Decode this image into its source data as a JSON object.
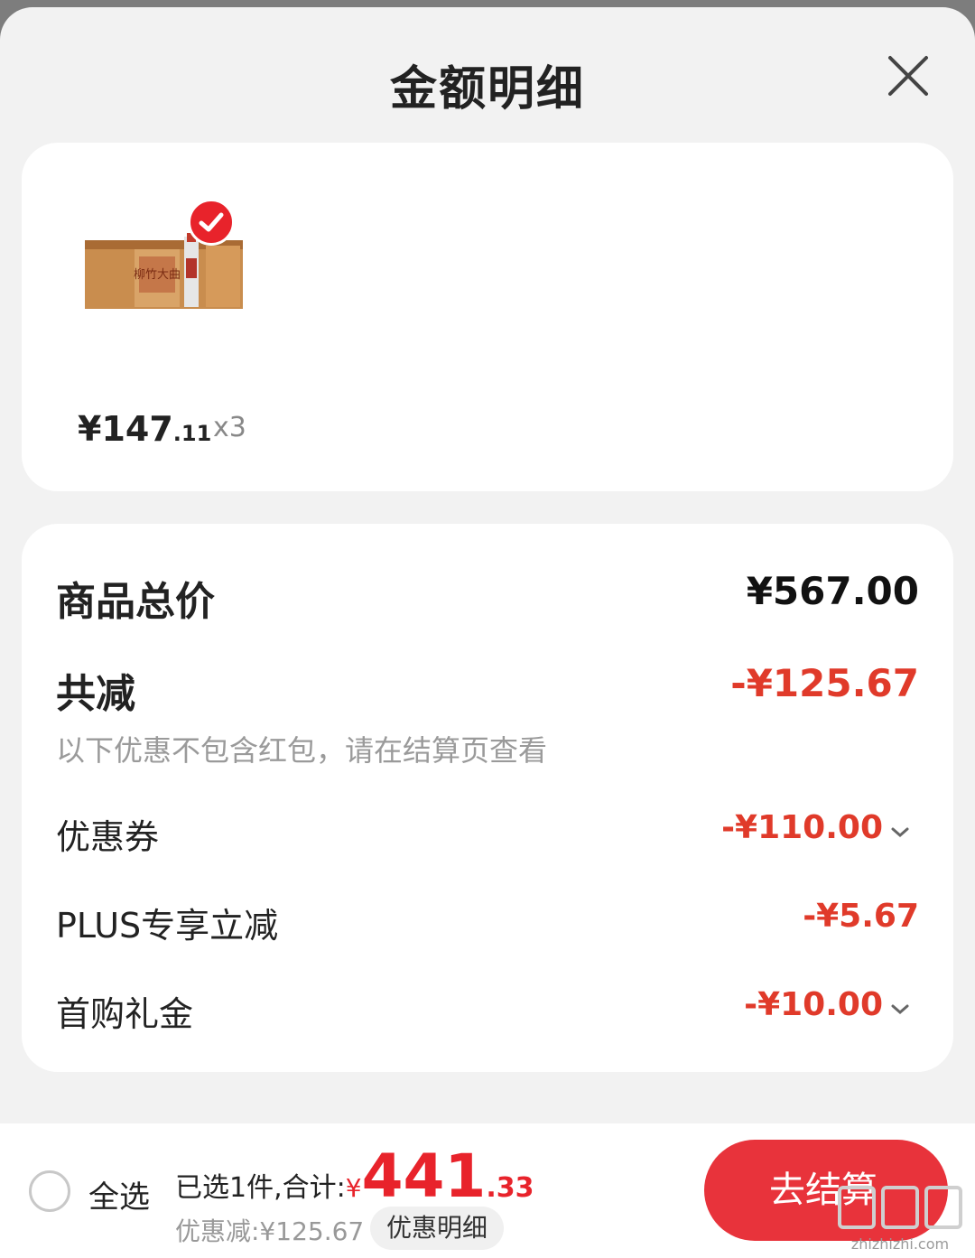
{
  "sheet": {
    "title": "金额明细"
  },
  "product": {
    "price_int": "¥147",
    "price_dec": ".11",
    "quantity": "x3",
    "thumb_text": "柳竹大曲"
  },
  "summary": {
    "total_label": "商品总价",
    "total_value": "¥567.00",
    "reduce_label": "共减",
    "reduce_value": "-¥125.67",
    "note": "以下优惠不包含红包，请在结算页查看",
    "items": [
      {
        "label": "优惠券",
        "value": "-¥110.00"
      },
      {
        "label": "PLUS专享立减",
        "value": "-¥5.67"
      },
      {
        "label": "首购礼金",
        "value": "-¥10.00"
      }
    ]
  },
  "bottom": {
    "select_all": "全选",
    "selected_prefix": "已选1件,合计:",
    "yen": "¥",
    "total_int": "441",
    "total_dec": ".33",
    "discount": "优惠减:¥125.67",
    "detail_button": "优惠明细",
    "checkout_button": "去结算"
  },
  "watermark": {
    "text": "zhizhizhi.com"
  },
  "colors": {
    "accent": "#e8232b",
    "price_red": "#e03a2a"
  }
}
